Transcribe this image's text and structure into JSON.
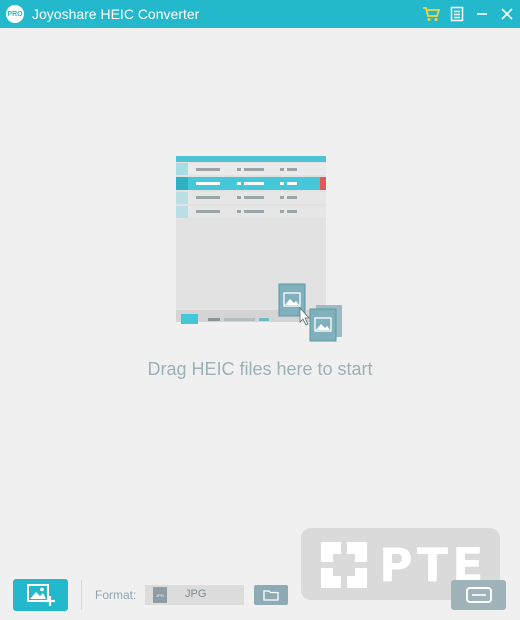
{
  "window": {
    "title": "Joyoshare HEIC Converter",
    "logo_text": "PRO"
  },
  "titlebar_icons": [
    "cart-icon",
    "menu-icon",
    "minimize-icon",
    "close-icon"
  ],
  "colors": {
    "accent": "#24b8cc",
    "cart": "#f2d43c",
    "hint_text": "#9cb0b8",
    "button_disabled": "#9fb3ba"
  },
  "main": {
    "drag_hint": "Drag HEIC files here to start"
  },
  "bottom": {
    "format_label": "Format:",
    "format_icon_text": "JPG",
    "format_value": "JPG"
  },
  "watermark": {
    "text": "PTE"
  }
}
